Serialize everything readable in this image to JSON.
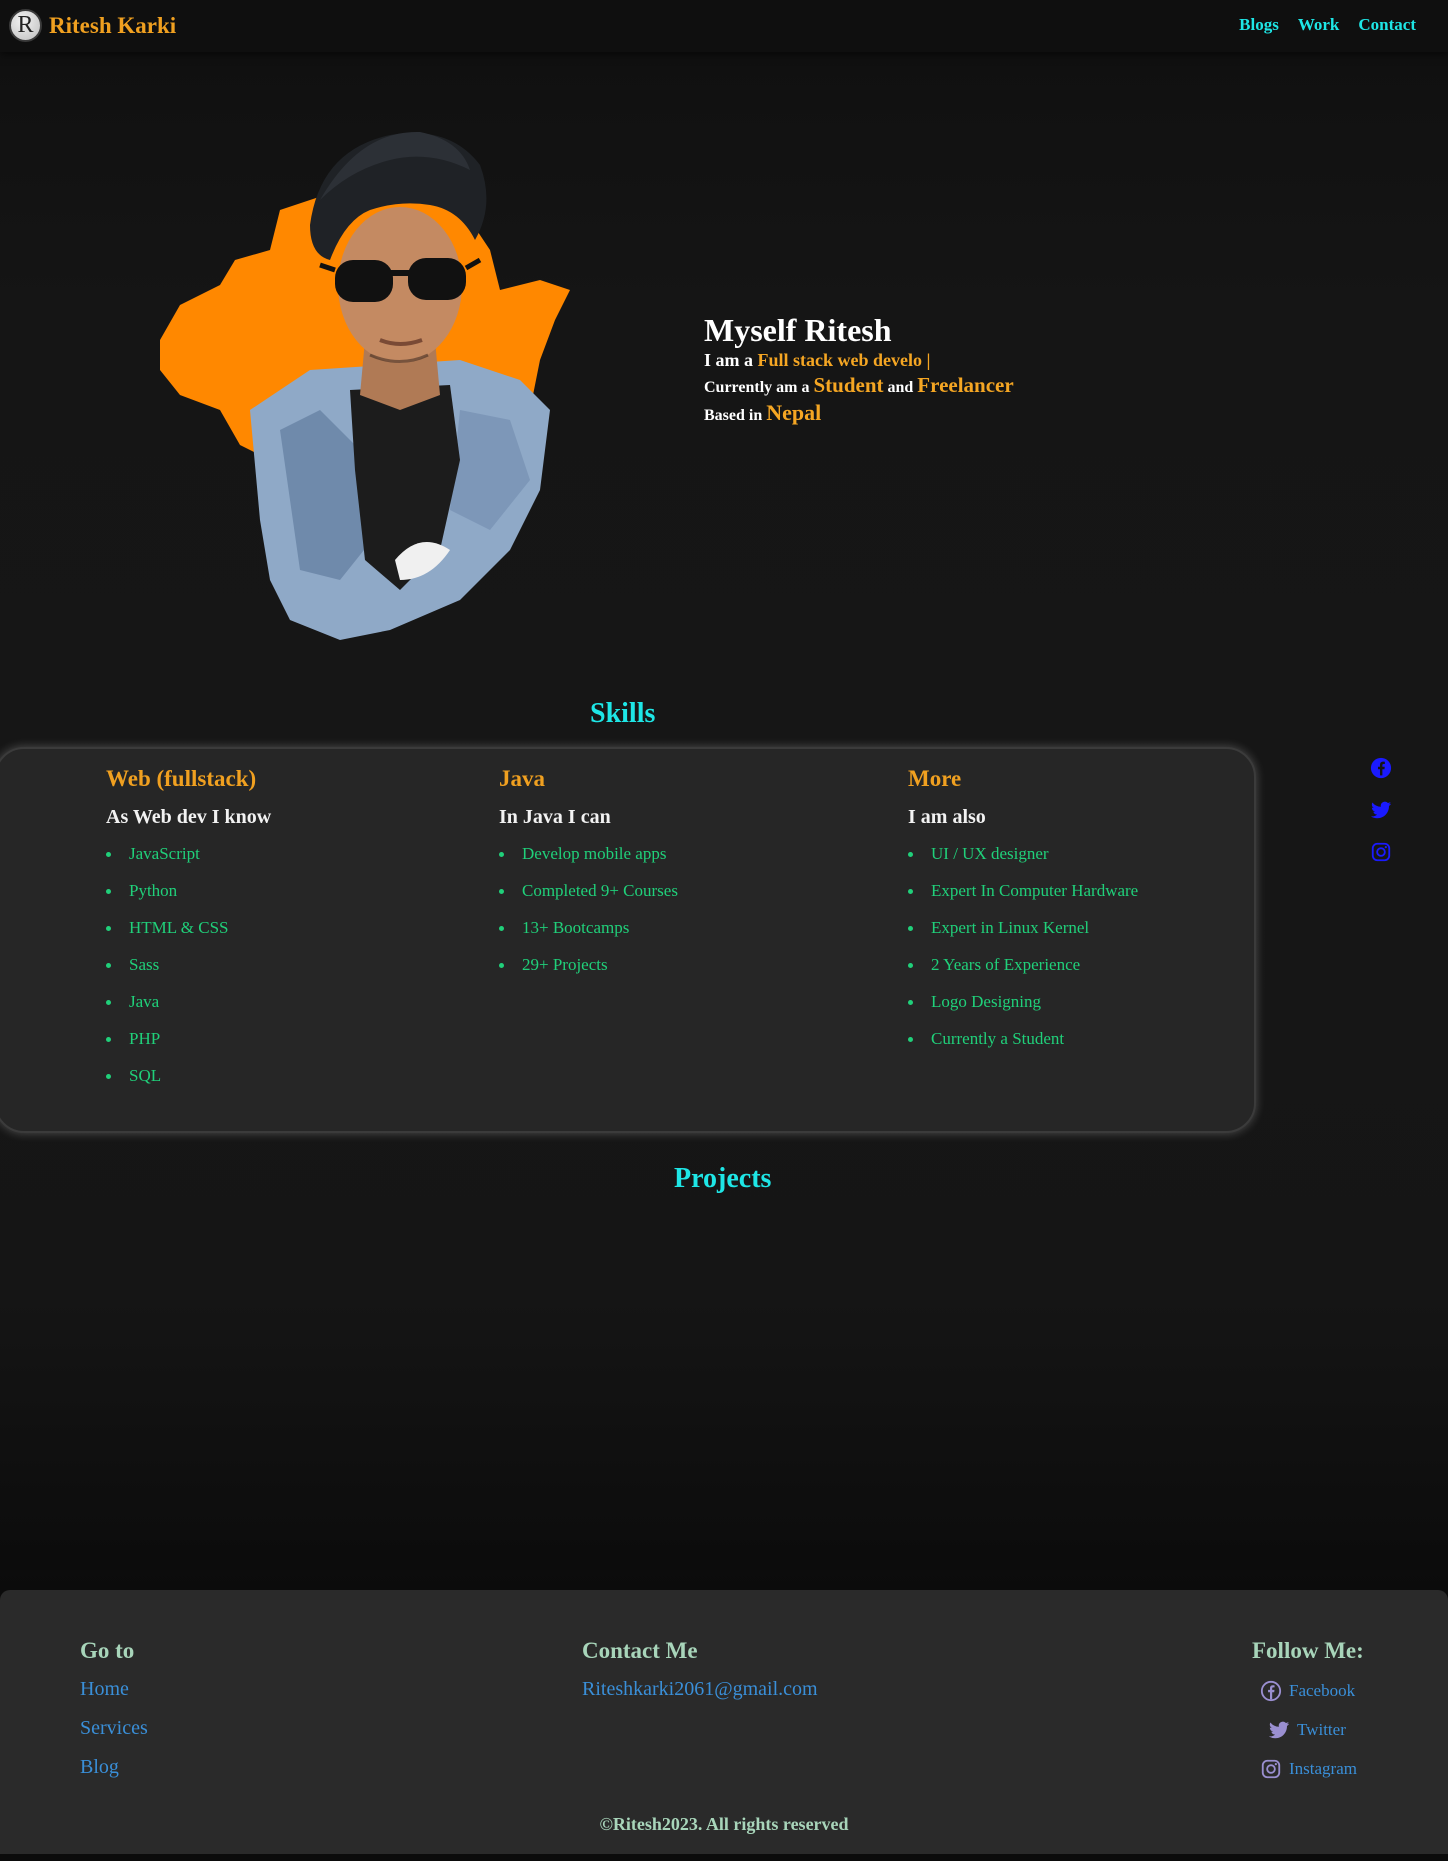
{
  "nav": {
    "logo_letter": "R",
    "brand": "Ritesh Karki",
    "links": [
      "Blogs",
      "Work",
      "Contact"
    ]
  },
  "hero": {
    "title": "Myself Ritesh",
    "line1_prefix": "I am a",
    "line1_highlight": "Full stack web develo |",
    "line2_prefix": "Currently am a",
    "line2_highlight1": "Student",
    "line2_mid": "and",
    "line2_highlight2": "Freelancer",
    "line3_prefix": "Based in",
    "line3_highlight": "Nepal",
    "photo_alt": "portrait-photo"
  },
  "skills": {
    "title": "Skills",
    "columns": [
      {
        "heading": "Web (fullstack)",
        "subheading": "As Web dev I know",
        "items": [
          "JavaScript",
          "Python",
          "HTML & CSS",
          "Sass",
          "Java",
          "PHP",
          "SQL"
        ]
      },
      {
        "heading": "Java",
        "subheading": "In Java I can",
        "items": [
          "Develop mobile apps",
          "Completed 9+ Courses",
          "13+ Bootcamps",
          "29+ Projects"
        ]
      },
      {
        "heading": "More",
        "subheading": "I am also",
        "items": [
          "UI / UX designer",
          "Expert In Computer Hardware",
          "Expert in Linux Kernel",
          "2 Years of Experience",
          "Logo Designing",
          "Currently a Student"
        ]
      }
    ]
  },
  "side_social": [
    "facebook-icon",
    "twitter-icon",
    "instagram-icon"
  ],
  "projects": {
    "title": "Projects"
  },
  "footer": {
    "goto_title": "Go to",
    "goto_links": [
      "Home",
      "Services",
      "Blog"
    ],
    "contact_title": "Contact Me",
    "email": "Riteshkarki2061@gmail.com",
    "follow_title": "Follow Me:",
    "follow_links": [
      "Facebook",
      "Twitter",
      "Instagram"
    ],
    "copyright": "©Ritesh2023. All rights reserved"
  },
  "colors": {
    "accent_orange": "#f5a623",
    "accent_cyan": "#1ee6e6",
    "skill_green": "#20d07a",
    "link_blue": "#3a8fd8",
    "side_icon_blue": "#1a1aff"
  }
}
